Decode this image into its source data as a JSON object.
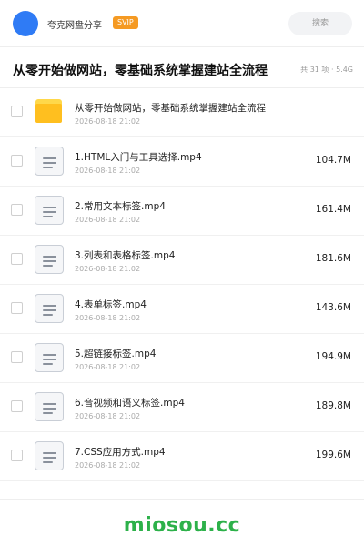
{
  "header": {
    "share_name": "夸克网盘分享",
    "badge": "SVIP",
    "search_placeholder": "搜索",
    "avatar_color": "#2f7bf5",
    "badge_color": "#f59a23"
  },
  "folder": {
    "title": "从零开始做网站，零基础系统掌握建站全流程",
    "meta": "共 31 项 · 5.4G"
  },
  "items": [
    {
      "name": "从零开始做网站，零基础系统掌握建站全流程",
      "date": "2026-08-18 21:02",
      "size": "",
      "icon": "folder-icon"
    },
    {
      "name": "1.HTML入门与工具选择.mp4",
      "date": "2026-08-18 21:02",
      "size": "104.7M",
      "icon": "video-file-icon"
    },
    {
      "name": "2.常用文本标签.mp4",
      "date": "2026-08-18 21:02",
      "size": "161.4M",
      "icon": "video-file-icon"
    },
    {
      "name": "3.列表和表格标签.mp4",
      "date": "2026-08-18 21:02",
      "size": "181.6M",
      "icon": "video-file-icon"
    },
    {
      "name": "4.表单标签.mp4",
      "date": "2026-08-18 21:02",
      "size": "143.6M",
      "icon": "video-file-icon"
    },
    {
      "name": "5.超链接标签.mp4",
      "date": "2026-08-18 21:02",
      "size": "194.9M",
      "icon": "video-file-icon"
    },
    {
      "name": "6.音视频和语义标签.mp4",
      "date": "2026-08-18 21:02",
      "size": "189.8M",
      "icon": "video-file-icon"
    },
    {
      "name": "7.CSS应用方式.mp4",
      "date": "2026-08-18 21:02",
      "size": "199.6M",
      "icon": "video-file-icon"
    }
  ],
  "footer": {
    "watermark": "miosou.cc",
    "watermark_color": "#2db14a"
  }
}
